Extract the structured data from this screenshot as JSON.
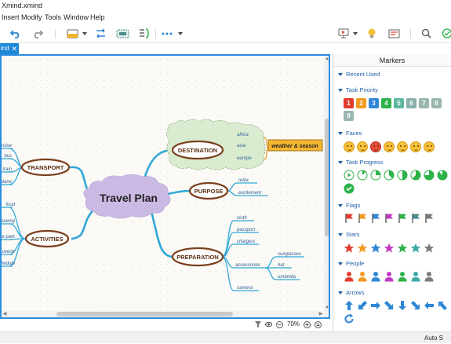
{
  "window": {
    "title": "Xmind.xmind"
  },
  "menu": [
    "Insert",
    "Modify",
    "Tools",
    "Window",
    "Help"
  ],
  "toolbar": {
    "icons": [
      "undo-icon",
      "redo-icon",
      "topic-style-icon",
      "relationship-icon",
      "boundary-icon",
      "summary-icon",
      "more-icon",
      "presentation-icon",
      "idea-icon",
      "outline-icon",
      "search-icon",
      "share-icon"
    ]
  },
  "tab": {
    "label": "ind",
    "close": "✕"
  },
  "mindmap": {
    "central": "Travel Plan",
    "branches": [
      {
        "label": "TRANSPORT",
        "children": [
          "cruise",
          "bus",
          "train",
          "plane"
        ]
      },
      {
        "label": "ACTIVITIES",
        "children": [
          "food",
          "seeing",
          "e park",
          "uvenir",
          "hedule"
        ]
      },
      {
        "label": "DESTINATION",
        "children": [
          "africa",
          "asia",
          "europe"
        ],
        "summary": "weather & season"
      },
      {
        "label": "PURPOSE",
        "children": [
          "relax",
          "excitement"
        ]
      },
      {
        "label": "PREPARATION",
        "children": [
          "cloth",
          "passport",
          "chargers",
          "accessories",
          "camera"
        ],
        "accessories_children": [
          "sunglasses",
          "hat",
          "umbrella"
        ]
      }
    ]
  },
  "status": {
    "zoom": "70%",
    "autosave": "Auto S"
  },
  "markers": {
    "title": "Markers",
    "sections": {
      "recent": "Recent Used",
      "priority": "Task Priority",
      "faces": "Faces",
      "progress": "Task Progress",
      "flags": "Flags",
      "stars": "Stars",
      "people": "People",
      "arrows": "Arrows"
    },
    "priority_items": [
      {
        "n": "1",
        "color": "#e23b2e"
      },
      {
        "n": "2",
        "color": "#f29a1f"
      },
      {
        "n": "3",
        "color": "#2f86d6"
      },
      {
        "n": "4",
        "color": "#2db34a"
      },
      {
        "n": "5",
        "color": "#5fb7a0"
      },
      {
        "n": "6",
        "color": "#8ab0ab"
      },
      {
        "n": "7",
        "color": "#9bb6b0"
      },
      {
        "n": "8",
        "color": "#9bb6b0"
      },
      {
        "n": "9",
        "color": "#9bb6b0"
      }
    ],
    "progress_items": [
      "0",
      "1/8",
      "2/8",
      "3/8",
      "4/8",
      "5/8",
      "6/8",
      "7/8",
      "done"
    ],
    "flag_colors": [
      "#e23b2e",
      "#f29a1f",
      "#2f86d6",
      "#c23bc4",
      "#2db34a",
      "#4a8a8a",
      "#7c7c7c"
    ],
    "star_colors": [
      "#e23b2e",
      "#f29a1f",
      "#2f86d6",
      "#c23bc4",
      "#2db34a",
      "#3aa9a6",
      "#7c7c7c"
    ],
    "people_colors": [
      "#e23b2e",
      "#f29a1f",
      "#2f86d6",
      "#c23bc4",
      "#2db34a",
      "#3aa9a6",
      "#7c7c7c"
    ],
    "arrow_color": "#2f86d6"
  }
}
